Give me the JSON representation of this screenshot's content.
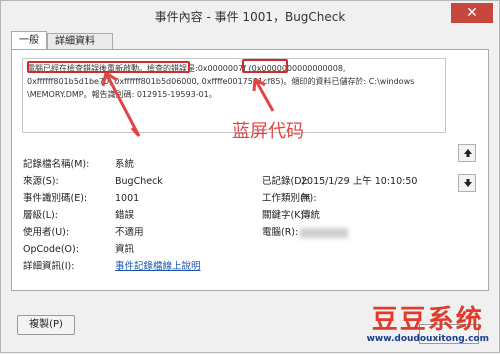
{
  "window": {
    "title": "事件內容 - 事件 1001，BugCheck",
    "close_glyph": "✕"
  },
  "tabs": [
    {
      "label": "一般"
    },
    {
      "label": "詳細資料"
    }
  ],
  "description": {
    "highlight1": "電腦已經在檢查錯誤後重新啟動。",
    "text_mid": "檢查的錯誤是:",
    "highlight2": "0x0000007f",
    "text_rest": " (0x0000000000000008,\n0xffffff801b5d1be70, 0xffffff801b5d06000, 0xffffe0017521cf85)。傾印的資料已儲存於: C:\\windows\n\\MEMORY.DMP。報告識別碼: 012915-19593-01。"
  },
  "annotation": {
    "label": "蓝屏代码",
    "color": "#e24545"
  },
  "properties": {
    "log_name_label": "記錄檔名稱(M):",
    "log_name_value": "系統",
    "source_label": "來源(S):",
    "source_value": "BugCheck",
    "logged_label": "已記錄(D):",
    "logged_value": "2015/1/29 上午 10:10:50",
    "event_id_label": "事件識別碼(E):",
    "event_id_value": "1001",
    "task_category_label": "工作類別(Y):",
    "task_category_value": "無",
    "level_label": "層級(L):",
    "level_value": "錯誤",
    "keywords_label": "關鍵字(K):",
    "keywords_value": "傳統",
    "user_label": "使用者(U):",
    "user_value": "不適用",
    "computer_label": "電腦(R):",
    "opcode_label": "OpCode(O):",
    "opcode_value": "資訊",
    "more_info_label": "詳細資訊(I):",
    "more_info_link": "事件記錄檔線上說明"
  },
  "buttons": {
    "copy_label": "複製(P)"
  },
  "watermark": {
    "brand": "豆豆系统",
    "url": "www.doudouxitong.com"
  }
}
